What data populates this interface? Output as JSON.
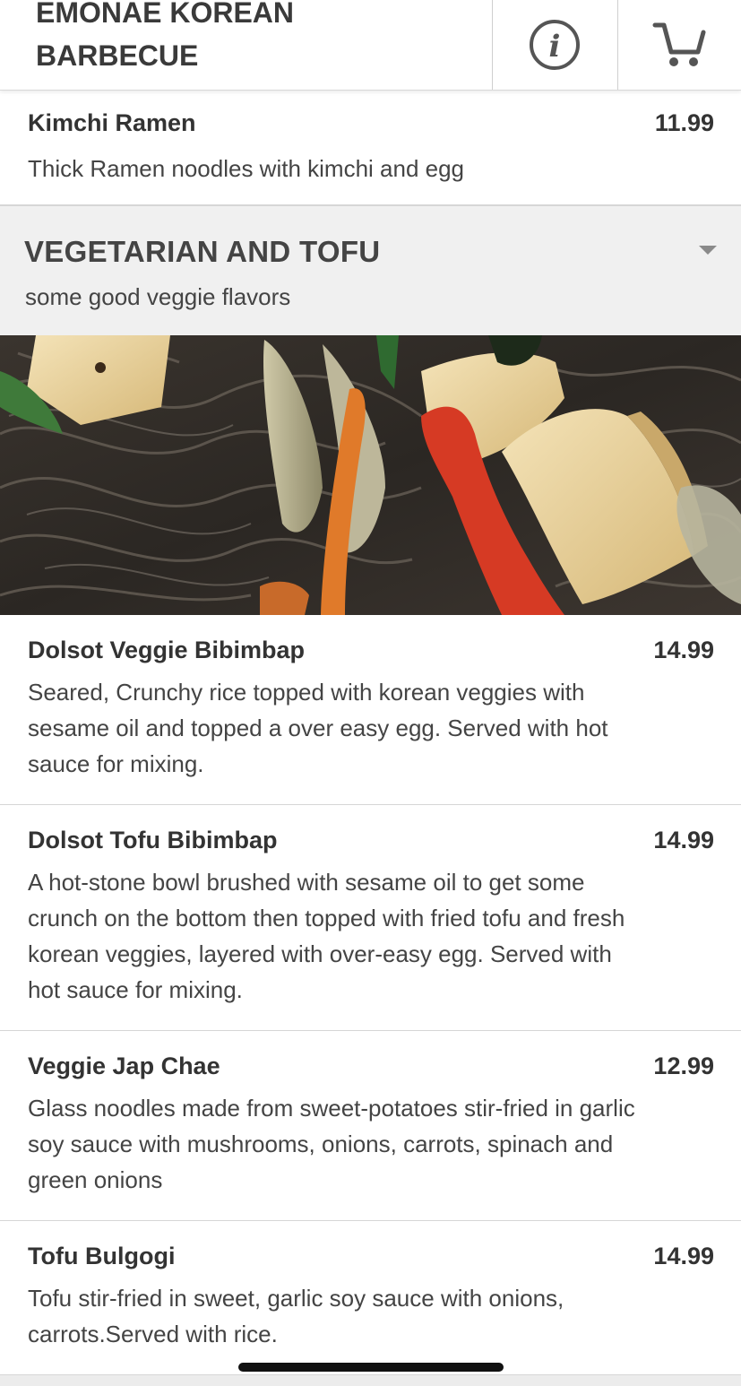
{
  "header": {
    "brand": "EMONAE KOREAN\nBARBECUE",
    "info_icon": "info-circle-icon",
    "cart_icon": "shopping-cart-icon"
  },
  "previous_items": [
    {
      "name": "Kimchi Ramen",
      "price": "11.99",
      "description": "Thick Ramen noodles with kimchi and egg"
    }
  ],
  "section": {
    "title": "VEGETARIAN AND TOFU",
    "subtitle": "some good veggie flavors",
    "expand_icon": "caret-down-icon",
    "image": "photo of stir-fried glass noodles with tofu and vegetables"
  },
  "items": [
    {
      "name": "Dolsot Veggie Bibimbap",
      "price": "14.99",
      "description": "Seared, Crunchy rice topped with korean veggies with sesame oil and topped a over easy egg. Served with hot sauce for mixing."
    },
    {
      "name": "Dolsot Tofu Bibimbap",
      "price": "14.99",
      "description": "A hot-stone bowl brushed with sesame oil to get some crunch on the bottom then topped with fried tofu and fresh korean veggies, layered with over-easy egg. Served with hot sauce for mixing."
    },
    {
      "name": "Veggie Jap Chae",
      "price": "12.99",
      "description": "Glass noodles made from sweet-potatoes stir-fried in garlic soy sauce with mushrooms, onions, carrots, spinach and green onions"
    },
    {
      "name": "Tofu Bulgogi",
      "price": "14.99",
      "description": "Tofu stir-fried in sweet, garlic soy sauce with onions, carrots.Served with rice."
    }
  ],
  "colors": {
    "text": "#333333",
    "section_bg": "#f0f0f0",
    "divider": "#d6d6d6"
  }
}
